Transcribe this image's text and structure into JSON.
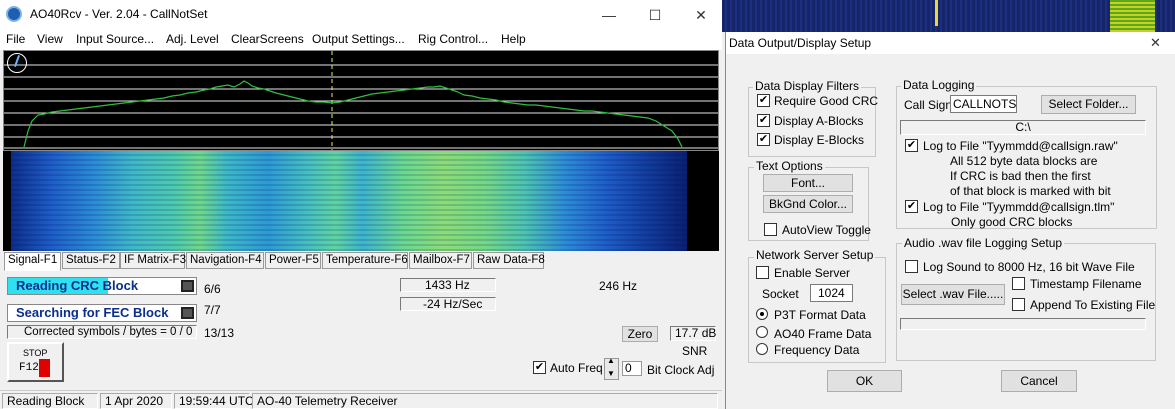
{
  "main_window": {
    "title": "AO40Rcv - Ver. 2.04 - CallNotSet",
    "caption_buttons": {
      "minimize": "—",
      "maximize": "☐",
      "close": "✕"
    },
    "menu": [
      "File",
      "View",
      "Input Source...",
      "Adj. Level",
      "ClearScreens",
      "Output Settings...",
      "Rig Control...",
      "Help"
    ],
    "tabs": [
      "Signal-F1",
      "Status-F2",
      "IF Matrix-F3",
      "Navigation-F4",
      "Power-F5",
      "Temperature-F6",
      "Mailbox-F7",
      "Raw Data-F8"
    ],
    "reading_crc": {
      "label": "Reading CRC Block",
      "count": "6/6"
    },
    "searching_fec": {
      "label": "Searching for FEC Block",
      "count": "7/7"
    },
    "corrected": {
      "label": "Corrected symbols / bytes = 0 / 0",
      "count": "13/13"
    },
    "freq": {
      "hz": "1433 Hz",
      "rate": "-24 Hz/Sec",
      "offset": "246 Hz"
    },
    "zero_button": "Zero",
    "snr": {
      "value": "17.7 dB",
      "label": "SNR"
    },
    "stop": {
      "line1": "STOP",
      "line2": "F12"
    },
    "auto_freq": {
      "label": "Auto Freq",
      "checked": true
    },
    "bit_clock": {
      "value": "0",
      "label": "Bit Clock Adj"
    },
    "status_bar": [
      "Reading Block",
      "1 Apr 2020",
      "19:59:44 UTC",
      "AO-40 Telemetry Receiver"
    ]
  },
  "dialog": {
    "title": "Data Output/Display Setup",
    "close": "✕",
    "display_filters": {
      "title": "Data Display Filters",
      "items": [
        {
          "label": "Require Good CRC",
          "checked": true
        },
        {
          "label": "Display A-Blocks",
          "checked": true
        },
        {
          "label": "Display E-Blocks",
          "checked": true
        }
      ]
    },
    "text_options": {
      "title": "Text Options",
      "font_button": "Font...",
      "bkgnd_button": "BkGnd Color...",
      "autoview": {
        "label": "AutoView Toggle",
        "checked": false
      }
    },
    "network": {
      "title": "Network Server Setup",
      "enable": {
        "label": "Enable Server",
        "checked": false
      },
      "socket_label": "Socket",
      "socket_value": "1024",
      "radios": [
        {
          "label": "P3T Format Data",
          "selected": true
        },
        {
          "label": "AO40 Frame Data",
          "selected": false
        },
        {
          "label": "Frequency Data",
          "selected": false
        }
      ]
    },
    "logging": {
      "title": "Data Logging",
      "callsign_label": "Call Sign",
      "callsign_value": "CALLNOTSE",
      "select_folder": "Select Folder...",
      "folder": "C:\\",
      "raw": {
        "label": "Log to File \"Tyymmdd@callsign.raw\"",
        "checked": true,
        "desc": [
          "All 512 byte data blocks are",
          "If CRC is bad then the first",
          "of that block is marked with bit"
        ]
      },
      "tlm": {
        "label": "Log to File \"Tyymmdd@callsign.tlm\"",
        "checked": true,
        "desc": "Only good CRC blocks"
      }
    },
    "audio": {
      "title": "Audio  .wav  file Logging Setup",
      "log_sound": {
        "label": "Log Sound to 8000 Hz, 16 bit Wave File",
        "checked": false
      },
      "select_wav": "Select .wav File.....",
      "timestamp": {
        "label": "Timestamp Filename",
        "checked": false
      },
      "append": {
        "label": "Append To Existing File",
        "checked": false
      }
    },
    "ok": "OK",
    "cancel": "Cancel"
  },
  "colors": {
    "progress_fill": "#2fe0f0",
    "trace": "#2fbf3f",
    "stop_red": "#e00000"
  }
}
